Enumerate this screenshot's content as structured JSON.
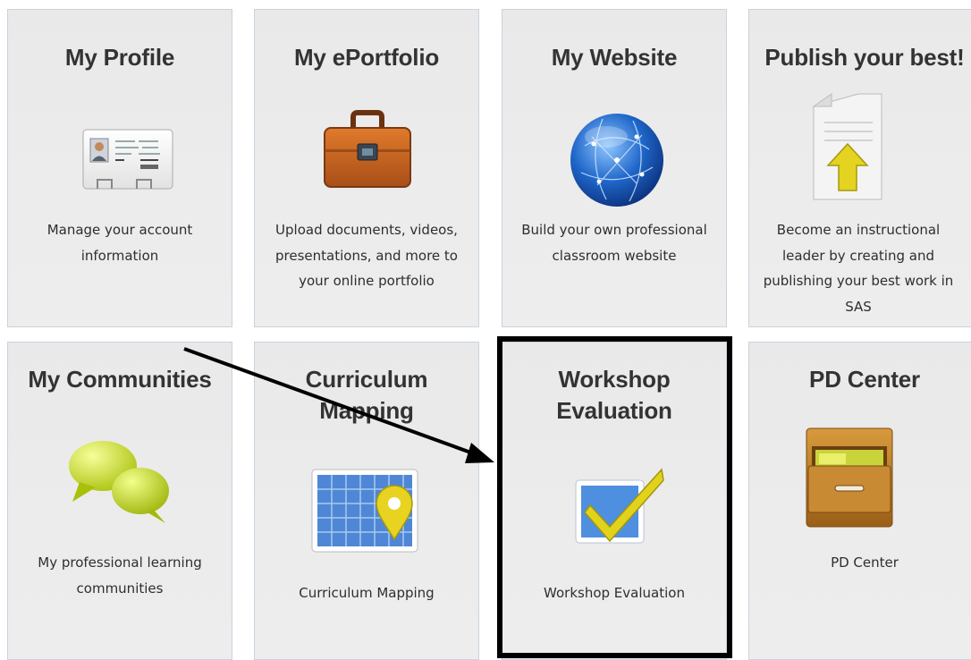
{
  "tiles": [
    {
      "title": "My Profile",
      "description": "Manage your account information",
      "icon": "id-card-icon"
    },
    {
      "title": "My ePortfolio",
      "description": "Upload documents, videos, presentations, and more to your online portfolio",
      "icon": "briefcase-icon"
    },
    {
      "title": "My Website",
      "description": "Build your own professional classroom website",
      "icon": "globe-icon"
    },
    {
      "title": "Publish your best!",
      "description": "Become an instructional leader by creating and publishing your best work in SAS",
      "icon": "document-upload-icon"
    },
    {
      "title": "My Communities",
      "description": "My professional learning communities",
      "icon": "speech-bubbles-icon"
    },
    {
      "title": "Curriculum Mapping",
      "description": "Curriculum Mapping",
      "icon": "map-pin-icon"
    },
    {
      "title": "Workshop Evaluation",
      "description": "Workshop Evaluation",
      "icon": "checkmark-icon"
    },
    {
      "title": "PD Center",
      "description": "PD Center",
      "icon": "file-cabinet-icon"
    }
  ],
  "annotation": {
    "highlight_color": "#000000",
    "arrow_color": "#000000"
  }
}
